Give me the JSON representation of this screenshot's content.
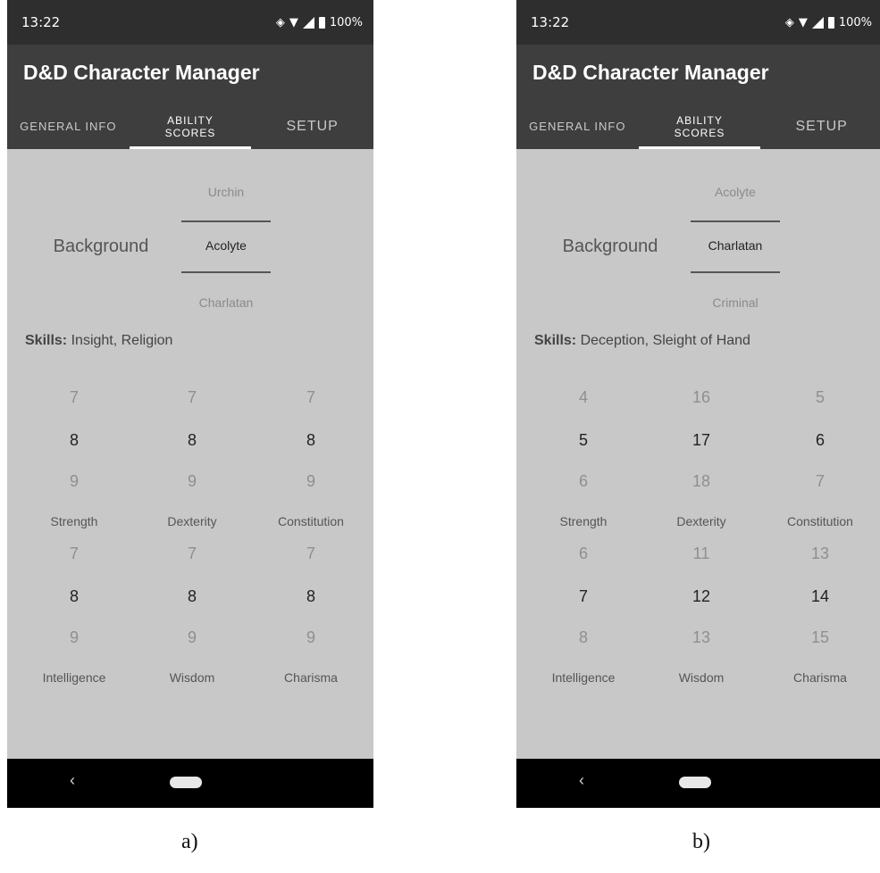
{
  "phones": [
    {
      "status": {
        "time": "13:22",
        "battery": "100%"
      },
      "app_title": "D&D Character Manager",
      "tabs": [
        {
          "label": "GENERAL INFO"
        },
        {
          "label": "ABILITY SCORES"
        },
        {
          "label": "SETUP"
        }
      ],
      "background": {
        "label": "Background",
        "prev": "Urchin",
        "current": "Acolyte",
        "next": "Charlatan"
      },
      "skills": {
        "label": "Skills:",
        "value": "Insight, Religion"
      },
      "abilities": [
        {
          "name": "Strength",
          "prev": "7",
          "current": "8",
          "next": "9"
        },
        {
          "name": "Dexterity",
          "prev": "7",
          "current": "8",
          "next": "9"
        },
        {
          "name": "Constitution",
          "prev": "7",
          "current": "8",
          "next": "9"
        },
        {
          "name": "Intelligence",
          "prev": "7",
          "current": "8",
          "next": "9"
        },
        {
          "name": "Wisdom",
          "prev": "7",
          "current": "8",
          "next": "9"
        },
        {
          "name": "Charisma",
          "prev": "7",
          "current": "8",
          "next": "9"
        }
      ],
      "nav": {
        "back": "‹"
      }
    },
    {
      "status": {
        "time": "13:22",
        "battery": "100%"
      },
      "app_title": "D&D Character Manager",
      "tabs": [
        {
          "label": "GENERAL INFO"
        },
        {
          "label": "ABILITY SCORES"
        },
        {
          "label": "SETUP"
        }
      ],
      "background": {
        "label": "Background",
        "prev": "Acolyte",
        "current": "Charlatan",
        "next": "Criminal"
      },
      "skills": {
        "label": "Skills:",
        "value": "Deception, Sleight of Hand"
      },
      "abilities": [
        {
          "name": "Strength",
          "prev": "4",
          "current": "5",
          "next": "6"
        },
        {
          "name": "Dexterity",
          "prev": "16",
          "current": "17",
          "next": "18"
        },
        {
          "name": "Constitution",
          "prev": "5",
          "current": "6",
          "next": "7"
        },
        {
          "name": "Intelligence",
          "prev": "6",
          "current": "7",
          "next": "8"
        },
        {
          "name": "Wisdom",
          "prev": "11",
          "current": "12",
          "next": "13"
        },
        {
          "name": "Charisma",
          "prev": "13",
          "current": "14",
          "next": "15"
        }
      ],
      "nav": {
        "back": "‹"
      }
    }
  ],
  "captions": [
    "a)",
    "b)"
  ]
}
